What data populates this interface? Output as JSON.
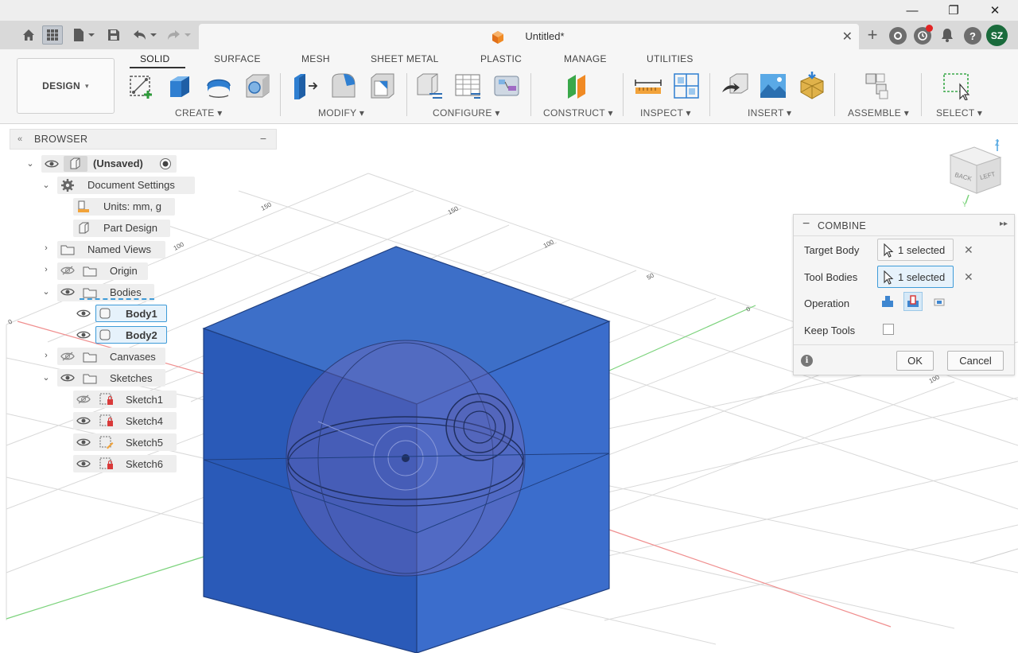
{
  "window": {
    "minimize": "—",
    "restore": "❐",
    "close": "✕"
  },
  "tab": {
    "title": "Untitled*",
    "close": "✕"
  },
  "user": {
    "initials": "SZ",
    "avatar_color": "#1a6b3c"
  },
  "ribbon": {
    "workspace": "DESIGN",
    "workspace_caret": "▾",
    "tabs": [
      "SOLID",
      "SURFACE",
      "MESH",
      "SHEET METAL",
      "PLASTIC",
      "MANAGE",
      "UTILITIES"
    ],
    "active_tab": "SOLID",
    "groups": [
      "CREATE ▾",
      "MODIFY ▾",
      "CONFIGURE ▾",
      "CONSTRUCT ▾",
      "INSPECT ▾",
      "INSERT ▾",
      "ASSEMBLE ▾",
      "SELECT ▾"
    ]
  },
  "browser": {
    "title": "BROWSER",
    "collapse": "−",
    "root": "(Unsaved)",
    "document_settings": "Document Settings",
    "units": "Units: mm, g",
    "part_design": "Part Design",
    "named_views": "Named Views",
    "origin": "Origin",
    "bodies": "Bodies",
    "body1": "Body1",
    "body2": "Body2",
    "canvases": "Canvases",
    "sketches": "Sketches",
    "sketch_items": [
      "Sketch1",
      "Sketch4",
      "Sketch5",
      "Sketch6"
    ]
  },
  "viewport": {
    "grid_labels": [
      "150",
      "100",
      "150",
      "100",
      "50",
      "50",
      "0",
      "100"
    ],
    "viewcube": {
      "back": "BACK",
      "left": "LEFT",
      "z": "Z",
      "y": "Y"
    }
  },
  "combine": {
    "title": "COMBINE",
    "target_body_label": "Target Body",
    "target_body_value": "1 selected",
    "tool_bodies_label": "Tool Bodies",
    "tool_bodies_value": "1 selected",
    "operation_label": "Operation",
    "keep_tools_label": "Keep Tools",
    "ok": "OK",
    "cancel": "Cancel",
    "info": "i",
    "clear": "✕",
    "operation_selected": "Cut"
  },
  "colors": {
    "accent": "#3e9bd8",
    "body_fill": "#2b5fbe",
    "sphere": "#7a63b5"
  }
}
